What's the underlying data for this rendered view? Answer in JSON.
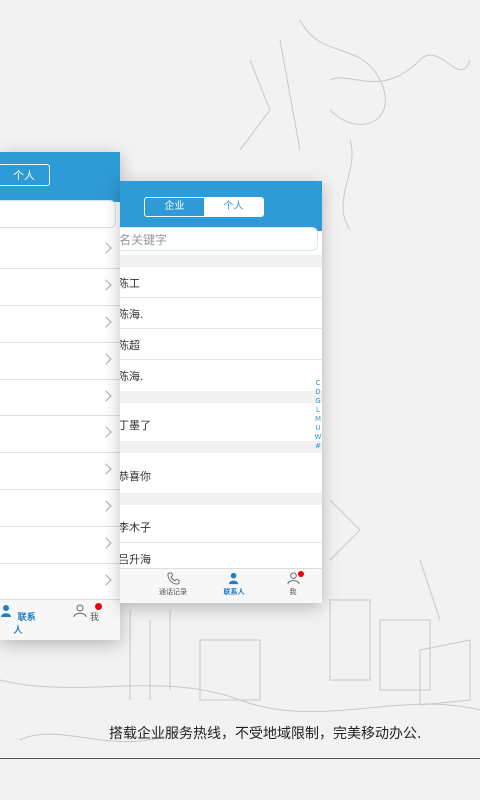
{
  "back_screen": {
    "tab_label": "个人",
    "tabbar": {
      "contacts_label": "联系人",
      "me_label": "我"
    }
  },
  "front_screen": {
    "segments": {
      "enterprise": "企业",
      "personal": "个人"
    },
    "search_placeholder": "名关键字",
    "contacts": [
      "陈工",
      "陈海.",
      "陈超",
      "陈海.",
      "丁墨了",
      "恭喜你",
      "李木子",
      "吕升海"
    ],
    "index_letters": [
      "C",
      "D",
      "G",
      "L",
      "M",
      "U",
      "W",
      "#"
    ],
    "tabbar": {
      "calls_label": "通话记录",
      "contacts_label": "联系人",
      "me_label": "我"
    }
  },
  "caption": "搭载企业服务热线，不受地域限制，完美移动办公.",
  "colors": {
    "accent": "#2e9ad6",
    "badge": "#e00000"
  }
}
